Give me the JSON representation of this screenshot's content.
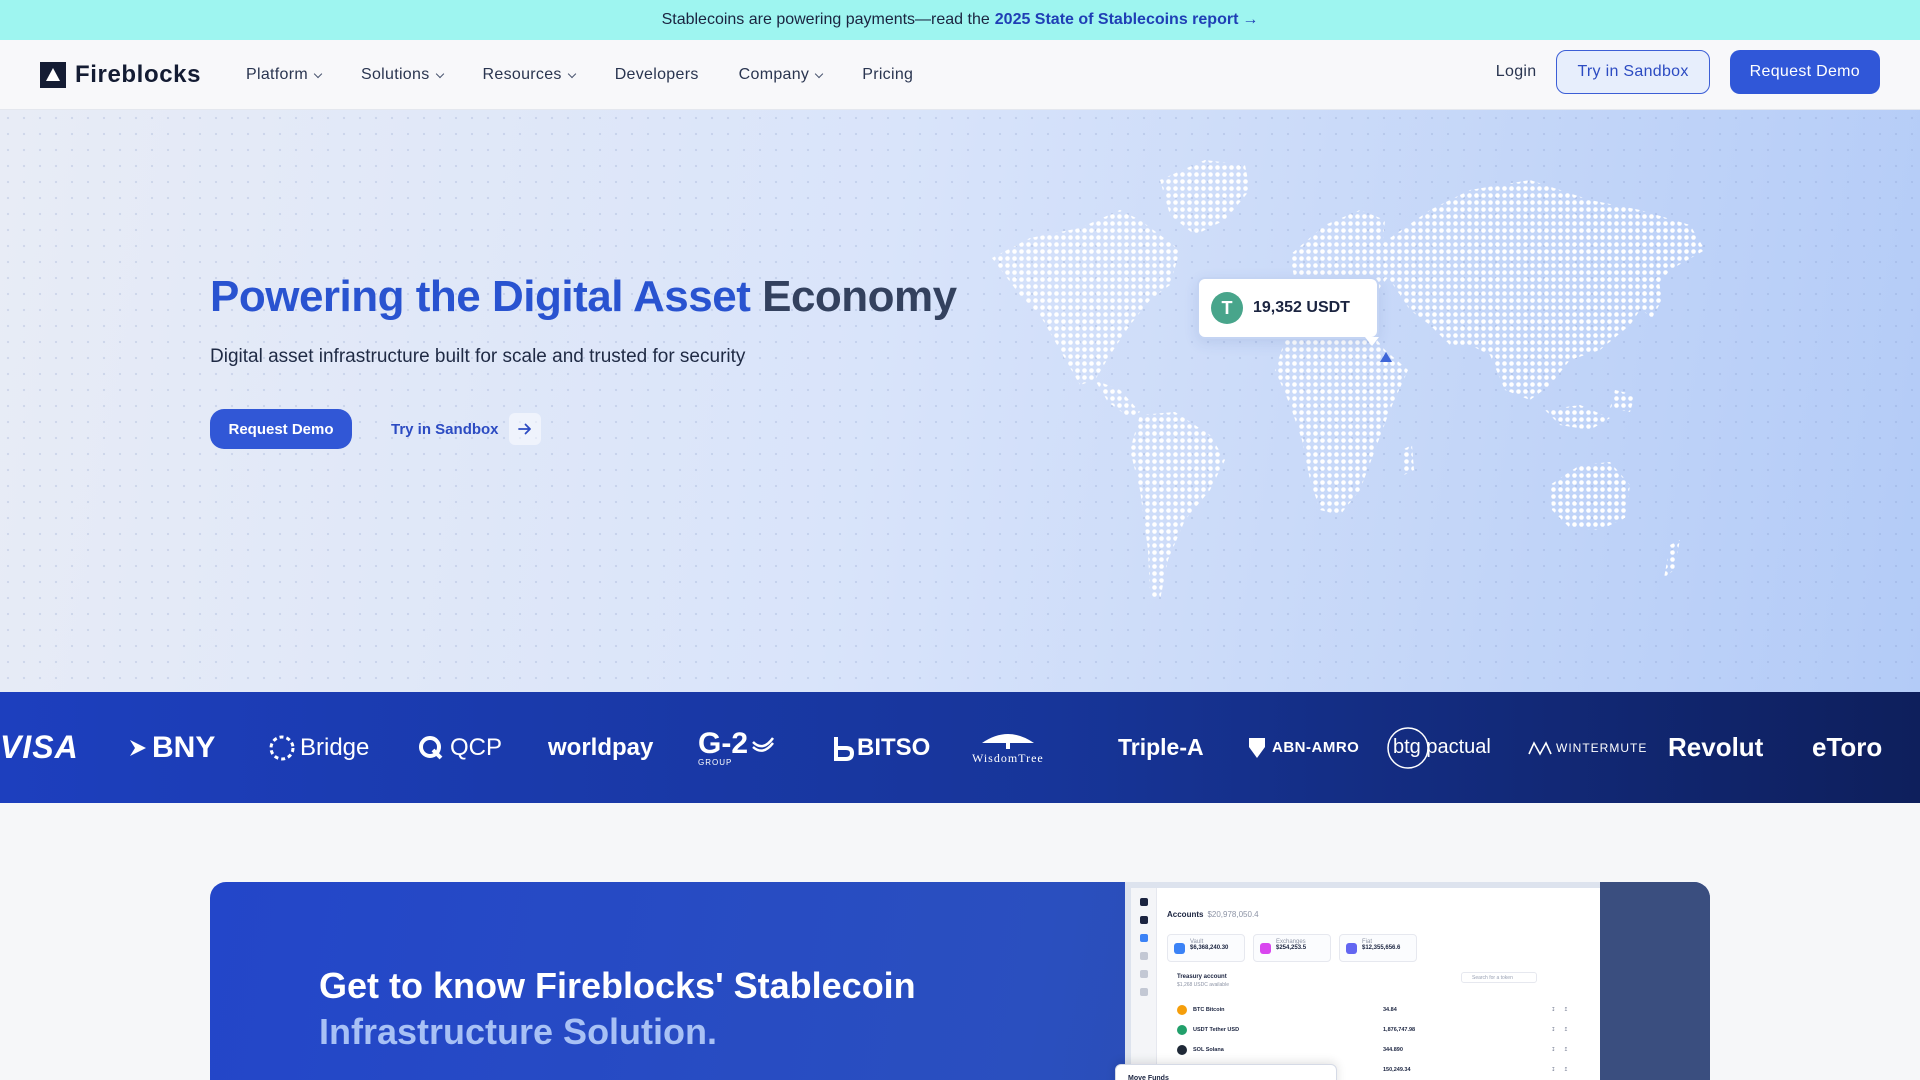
{
  "announcement": {
    "text": "Stablecoins are powering payments—read the",
    "link_text": "2025 State of Stablecoins report",
    "arrow": "→"
  },
  "nav": {
    "brand": "Fireblocks",
    "items": [
      {
        "label": "Platform",
        "dropdown": true
      },
      {
        "label": "Solutions",
        "dropdown": true
      },
      {
        "label": "Resources",
        "dropdown": true
      },
      {
        "label": "Developers",
        "dropdown": false
      },
      {
        "label": "Company",
        "dropdown": true
      },
      {
        "label": "Pricing",
        "dropdown": false
      }
    ],
    "login": "Login",
    "sandbox_button": "Try in Sandbox",
    "demo_button": "Request Demo"
  },
  "hero": {
    "title_highlight": "Powering the Digital Asset",
    "title_rest": "Economy",
    "subtitle": "Digital asset infrastructure built for scale and trusted for security",
    "cta_primary": "Request Demo",
    "cta_secondary": "Try in Sandbox",
    "tooltip_value": "19,352 USDT",
    "tooltip_icon_symbol": "T"
  },
  "partners": [
    "VISA",
    "BNY",
    "Bridge",
    "QCP",
    "worldpay",
    "G-2",
    "BITSO",
    "WisdomTree",
    "Triple-A",
    "ABN-AMRO",
    "btg pactual",
    "WINTERMUTE",
    "Revolut",
    "eToro"
  ],
  "partner_sublabels": {
    "g2": "GROUP"
  },
  "section": {
    "title_line1": "Get to know Fireblocks' Stablecoin",
    "title_line2": "Infrastructure Solution."
  },
  "dashboard": {
    "title": "Accounts",
    "total": "$20,978,050.4",
    "cards": [
      {
        "label": "Vault",
        "value": "$6,368,240.30",
        "color": "#3b82f6"
      },
      {
        "label": "Exchanges",
        "value": "$254,253.5",
        "color": "#d946ef"
      },
      {
        "label": "Fiat",
        "value": "$12,355,656.6",
        "color": "#6366f1"
      }
    ],
    "sub_title": "Treasury account",
    "sub_caption": "$1,268 USDC available",
    "search_placeholder": "Search for a token",
    "rows": [
      {
        "name": "BTC Bitcoin",
        "amount": "34.84",
        "color": "#f59e0b"
      },
      {
        "name": "USDT Tether USD",
        "amount": "1,876,747.98",
        "color": "#22a06b"
      },
      {
        "name": "SOL Solana",
        "amount": "344.890",
        "color": "#1f2937"
      },
      {
        "name": "",
        "amount": "150,249.34",
        "color": "#94a3b8"
      }
    ],
    "dialog_title": "Move Funds"
  },
  "colors": {
    "announcement_bg": "#9ef5f0",
    "primary_blue": "#3157d6",
    "hero_title_blue": "#2953d0",
    "logo_strip": "#173599",
    "tether_green": "#48a58b"
  }
}
